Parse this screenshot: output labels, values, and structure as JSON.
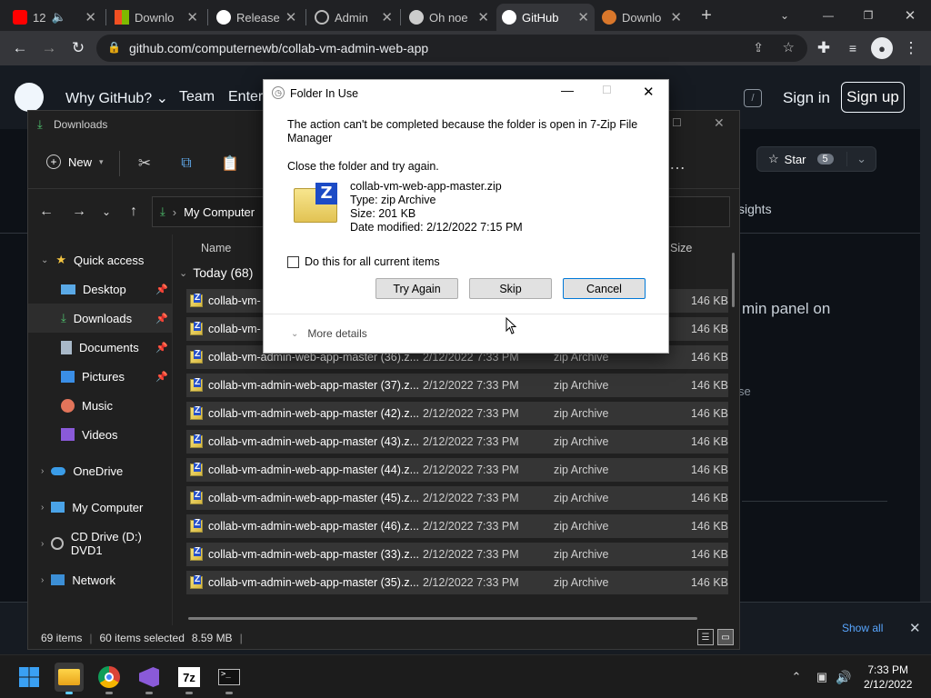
{
  "browser": {
    "tabs": [
      {
        "label": "12 ",
        "favicon": "youtube-icon",
        "extra": "audio-icon"
      },
      {
        "label": "Downlo",
        "favicon": "microsoft-icon"
      },
      {
        "label": "Release",
        "favicon": "github-icon"
      },
      {
        "label": "Admin",
        "favicon": "globe-icon"
      },
      {
        "label": "Oh noe",
        "favicon": "app-icon"
      },
      {
        "label": "GitHub",
        "favicon": "github-icon"
      },
      {
        "label": "Downlo",
        "favicon": "app-icon"
      }
    ],
    "url": "github.com/computernewb/collab-vm-admin-web-app"
  },
  "github": {
    "nav": [
      "Why GitHub?",
      "Team",
      "Enter"
    ],
    "slash": "/",
    "sign_in": "Sign in",
    "sign_up": "Sign up",
    "star_label": "Star",
    "star_count": "5",
    "insights": "sights",
    "about_fragment": "min panel on",
    "license_fragment": "se",
    "banner_show_all": "Show all"
  },
  "explorer": {
    "title": "Downloads",
    "new_label": "New",
    "breadcrumb": "My Computer",
    "nav": [
      {
        "label": "Quick access",
        "icon": "star-icon"
      },
      {
        "label": "Desktop",
        "icon": "desktop-icon",
        "pinned": true
      },
      {
        "label": "Downloads",
        "icon": "download-icon",
        "pinned": true
      },
      {
        "label": "Documents",
        "icon": "documents-icon",
        "pinned": true
      },
      {
        "label": "Pictures",
        "icon": "pictures-icon",
        "pinned": true
      },
      {
        "label": "Music",
        "icon": "music-icon"
      },
      {
        "label": "Videos",
        "icon": "videos-icon"
      },
      {
        "label": "OneDrive",
        "icon": "cloud-icon"
      },
      {
        "label": "My Computer",
        "icon": "computer-icon"
      },
      {
        "label": "CD Drive (D:) DVD1",
        "icon": "disc-icon"
      },
      {
        "label": "Network",
        "icon": "network-icon"
      }
    ],
    "columns": {
      "name": "Name",
      "size": "Size"
    },
    "group_label": "Today (68)",
    "rows": [
      {
        "name": "collab-vm-",
        "date": "",
        "type": "",
        "size": "146 KB"
      },
      {
        "name": "collab-vm-",
        "date": "",
        "type": "",
        "size": "146 KB"
      },
      {
        "name": "collab-vm-admin-web-app-master (36).z...",
        "date": "2/12/2022 7:33 PM",
        "type": "zip Archive",
        "size": "146 KB"
      },
      {
        "name": "collab-vm-admin-web-app-master (37).z...",
        "date": "2/12/2022 7:33 PM",
        "type": "zip Archive",
        "size": "146 KB"
      },
      {
        "name": "collab-vm-admin-web-app-master (42).z...",
        "date": "2/12/2022 7:33 PM",
        "type": "zip Archive",
        "size": "146 KB"
      },
      {
        "name": "collab-vm-admin-web-app-master (43).z...",
        "date": "2/12/2022 7:33 PM",
        "type": "zip Archive",
        "size": "146 KB"
      },
      {
        "name": "collab-vm-admin-web-app-master (44).z...",
        "date": "2/12/2022 7:33 PM",
        "type": "zip Archive",
        "size": "146 KB"
      },
      {
        "name": "collab-vm-admin-web-app-master (45).z...",
        "date": "2/12/2022 7:33 PM",
        "type": "zip Archive",
        "size": "146 KB"
      },
      {
        "name": "collab-vm-admin-web-app-master (46).z...",
        "date": "2/12/2022 7:33 PM",
        "type": "zip Archive",
        "size": "146 KB"
      },
      {
        "name": "collab-vm-admin-web-app-master (33).z...",
        "date": "2/12/2022 7:33 PM",
        "type": "zip Archive",
        "size": "146 KB"
      },
      {
        "name": "collab-vm-admin-web-app-master (35).z...",
        "date": "2/12/2022 7:33 PM",
        "type": "zip Archive",
        "size": "146 KB"
      }
    ],
    "status": {
      "items": "69 items",
      "selected": "60 items selected",
      "size": "8.59 MB"
    }
  },
  "dialog": {
    "title": "Folder In Use",
    "message": "The action can't be completed because the folder is open in 7-Zip File Manager",
    "instruction": "Close the folder and try again.",
    "file": {
      "name": "collab-vm-web-app-master.zip",
      "type": "Type: zip Archive",
      "size": "Size: 201 KB",
      "modified": "Date modified: 2/12/2022 7:15 PM"
    },
    "checkbox_label": "Do this for all current items",
    "checkbox_checked": false,
    "buttons": {
      "try_again": "Try Again",
      "skip": "Skip",
      "cancel": "Cancel"
    },
    "more_details": "More details"
  },
  "taskbar": {
    "time": "7:33 PM",
    "date": "2/12/2022",
    "apps": [
      "file-explorer-icon",
      "chrome-icon",
      "visual-studio-icon",
      "7zip-icon",
      "terminal-icon"
    ],
    "zip_label": "7z"
  },
  "colors": {
    "accent": "#0078d7",
    "folder": "#e8c24a",
    "github_bg": "#0d1117"
  }
}
